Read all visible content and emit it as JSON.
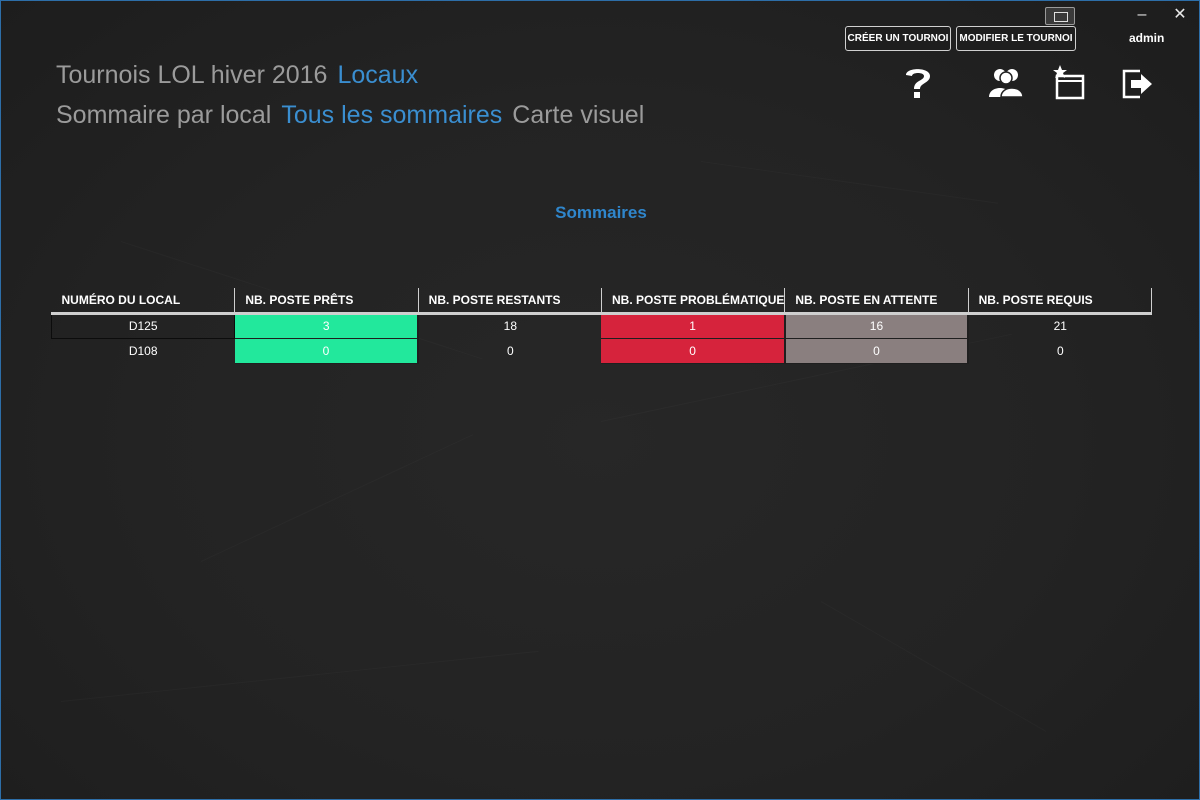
{
  "window": {
    "restore_icon": "restore-icon",
    "minimize_label": "–",
    "close_label": "✕",
    "border_color": "#2d6ea8"
  },
  "toolbar": {
    "create_label": "CRÉER UN TOURNOI",
    "modify_label": "MODIFIER LE TOURNOI",
    "user": "admin",
    "icons": [
      "help-icon",
      "users-icon",
      "new-tab-icon",
      "logout-icon"
    ]
  },
  "header": {
    "tournament": "Tournois LOL hiver 2016",
    "locaux_link": "Locaux",
    "nav": {
      "by_local": "Sommaire par local",
      "all": "Tous les sommaires",
      "map": "Carte visuel"
    }
  },
  "main": {
    "section_title": "Sommaires",
    "columns": [
      "NUMÉRO DU LOCAL",
      "NB. POSTE PRÊTS",
      "NB. POSTE RESTANTS",
      "NB. POSTE PROBLÉMATIQUES",
      "NB. POSTE EN ATTENTE",
      "NB. POSTE REQUIS"
    ],
    "rows": [
      [
        "D125",
        "3",
        "18",
        "1",
        "16",
        "21"
      ],
      [
        "D108",
        "0",
        "0",
        "0",
        "0",
        "0"
      ]
    ]
  },
  "colors": {
    "accent": "#3a8ed0",
    "ready": "#22e89c",
    "problem": "#d6233c",
    "waiting": "#8a7f7f"
  }
}
